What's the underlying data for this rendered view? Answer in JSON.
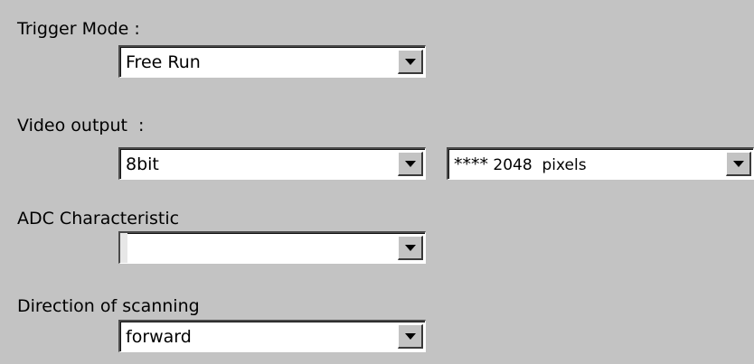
{
  "trigger_mode": {
    "label": "Trigger Mode :",
    "selected": "Free Run"
  },
  "video_output": {
    "label": "Video output  :",
    "bit_depth_selected": "8bit",
    "pixels_prefix": "****",
    "pixels_selected": " 2048  pixels"
  },
  "adc_characteristic": {
    "label": "ADC Characteristic",
    "selected": ""
  },
  "direction_of_scanning": {
    "label": "Direction of scanning",
    "selected": "forward"
  },
  "icons": {
    "dropdown": "chevron-down-icon"
  },
  "colors": {
    "background": "#c3c3c3",
    "field": "#ffffff"
  }
}
